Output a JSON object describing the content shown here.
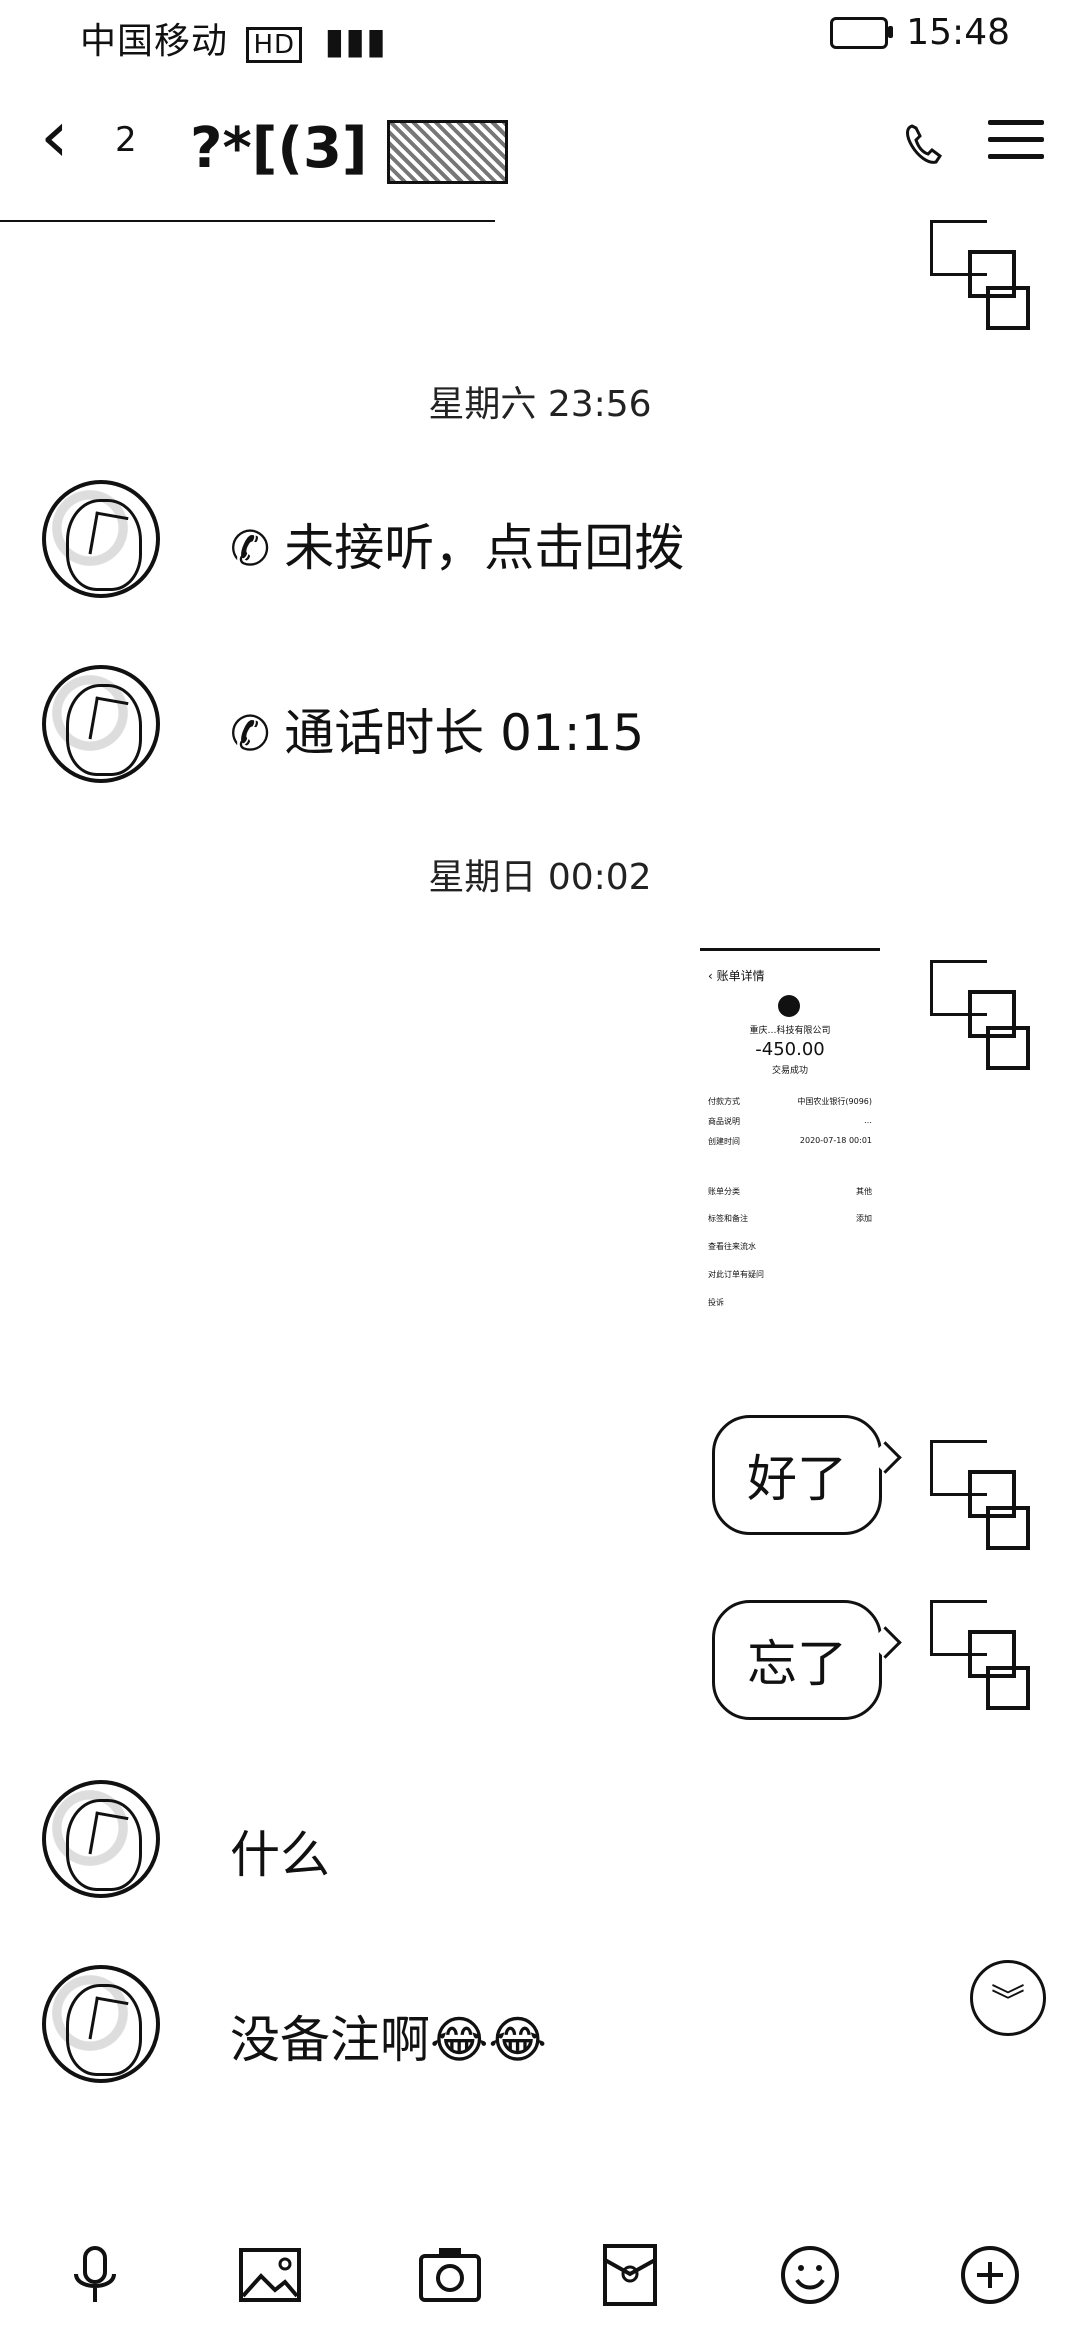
{
  "status_bar": {
    "carrier": "中国移动",
    "network": "HD",
    "time": "15:48"
  },
  "header": {
    "back_icon": "chevron-left-icon",
    "unread": "2",
    "title": "?*[(3]",
    "call_icon": "phone-icon",
    "menu_icon": "menu-icon"
  },
  "chat": {
    "times": [
      {
        "label": "星期六 23:56"
      },
      {
        "label": "星期日 00:02"
      }
    ],
    "incoming": [
      {
        "text": "未接听，点击回拨"
      },
      {
        "text": "通话时长 01:15"
      },
      {
        "text": "什么"
      },
      {
        "text": "没备注啊😂😂"
      }
    ],
    "outgoing": [
      {
        "text": "好了"
      },
      {
        "text": "忘了"
      }
    ],
    "receipt": {
      "title": "账单详情",
      "merchant": "重庆…科技有限公司",
      "amount": "-450.00",
      "status": "交易成功",
      "rows": [
        {
          "label": "付款方式",
          "value": "中国农业银行(9096)"
        },
        {
          "label": "商品说明",
          "value": "…"
        },
        {
          "label": "创建时间",
          "value": "2020-07-18 00:01"
        },
        {
          "label": "账单分类",
          "value": "其他"
        },
        {
          "label": "标签和备注",
          "value": "添加"
        },
        {
          "label": "查看往来流水",
          "value": ""
        },
        {
          "label": "对此订单有疑问",
          "value": ""
        },
        {
          "label": "投诉",
          "value": ""
        }
      ]
    }
  },
  "toolbar": {
    "items": [
      {
        "icon": "mic-icon"
      },
      {
        "icon": "image-icon"
      },
      {
        "icon": "camera-icon"
      },
      {
        "icon": "red-packet-icon"
      },
      {
        "icon": "emoji-icon"
      },
      {
        "icon": "plus-icon"
      }
    ]
  }
}
